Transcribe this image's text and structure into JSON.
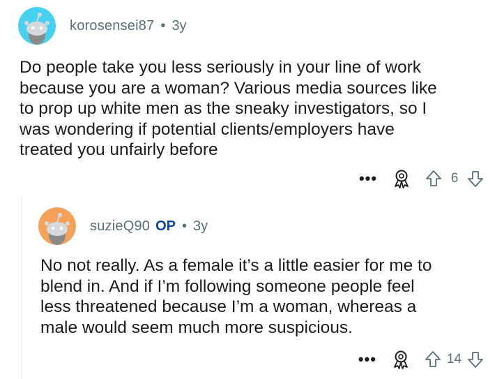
{
  "comments": [
    {
      "username": "korosensei87",
      "op_label": "",
      "separator": "•",
      "age": "3y",
      "avatar_color": "#46d1f0",
      "body": "Do people take you less seriously in your line of work\nbecause you are a woman? Various media sources like\nto prop up white men as the sneaky investigators, so I\nwas wondering if potential clients/employers have\ntreated you unfairly before",
      "more_label": "•••",
      "score": "6",
      "icons": {
        "more": "more-dots-icon",
        "award": "award-icon",
        "upvote": "upvote-arrow-icon",
        "downvote": "downvote-arrow-icon"
      }
    },
    {
      "username": "suzieQ90",
      "op_label": "OP",
      "separator": "•",
      "age": "3y",
      "avatar_color": "#f6a15a",
      "body": "No not really. As a female it’s a little easier for me to\nblend in. And if I’m following someone people feel\nless threatened because I’m a woman, whereas a\nmale would seem much more suspicious.",
      "more_label": "•••",
      "score": "14",
      "icons": {
        "more": "more-dots-icon",
        "award": "award-icon",
        "upvote": "upvote-arrow-icon",
        "downvote": "downvote-arrow-icon"
      }
    }
  ],
  "colors": {
    "meta_text": "#576f76",
    "op_blue": "#0a449b",
    "body_text": "#1c1c1c",
    "thread_line": "#edeff1"
  }
}
